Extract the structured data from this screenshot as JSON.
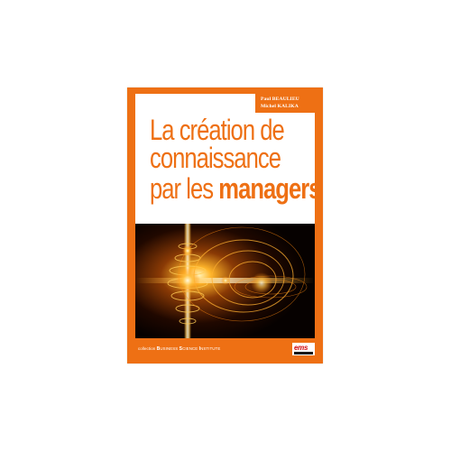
{
  "book": {
    "authors": [
      "Paul BEAULIEU",
      "Michel KALIKA"
    ],
    "title_lines": [
      "La création de",
      "connaissance",
      {
        "prefix": "par les ",
        "emphasis": "managers"
      }
    ],
    "collection": {
      "prefix": "collection ",
      "words": [
        {
          "initial": "B",
          "rest": "USINESS "
        },
        {
          "initial": "S",
          "rest": "CIENCE "
        },
        {
          "initial": "I",
          "rest": "NSTITUTE"
        }
      ]
    },
    "publisher": {
      "logo_text": "ems",
      "logo_icon": "ems-publisher-logo-icon"
    },
    "cover_image": {
      "icon": "golden-light-rings-image"
    },
    "colors": {
      "accent": "#ee7014",
      "background": "#ffffff",
      "logo_red": "#d10a10"
    }
  }
}
